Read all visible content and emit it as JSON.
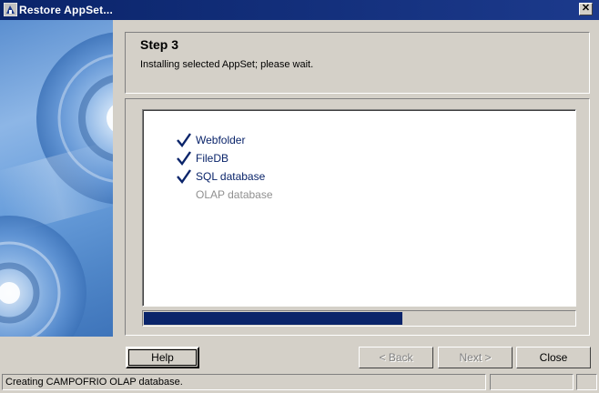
{
  "window": {
    "title": "Restore AppSet...",
    "close_glyph": "✕"
  },
  "header": {
    "step_title": "Step 3",
    "description": "Installing selected AppSet; please wait."
  },
  "tasks": [
    {
      "label": "Webfolder",
      "state": "done"
    },
    {
      "label": "FileDB",
      "state": "done"
    },
    {
      "label": "SQL database",
      "state": "done"
    },
    {
      "label": "OLAP database",
      "state": "pending"
    }
  ],
  "progress": {
    "fraction": 0.6
  },
  "buttons": {
    "help": "Help",
    "back": "< Back",
    "next": "Next >",
    "close": "Close"
  },
  "status": {
    "message": "Creating CAMPOFRIO OLAP database."
  },
  "colors": {
    "titlebar": "#0a246a",
    "progress": "#0a246a",
    "check": "#0a246a",
    "pending_text": "#909090"
  }
}
